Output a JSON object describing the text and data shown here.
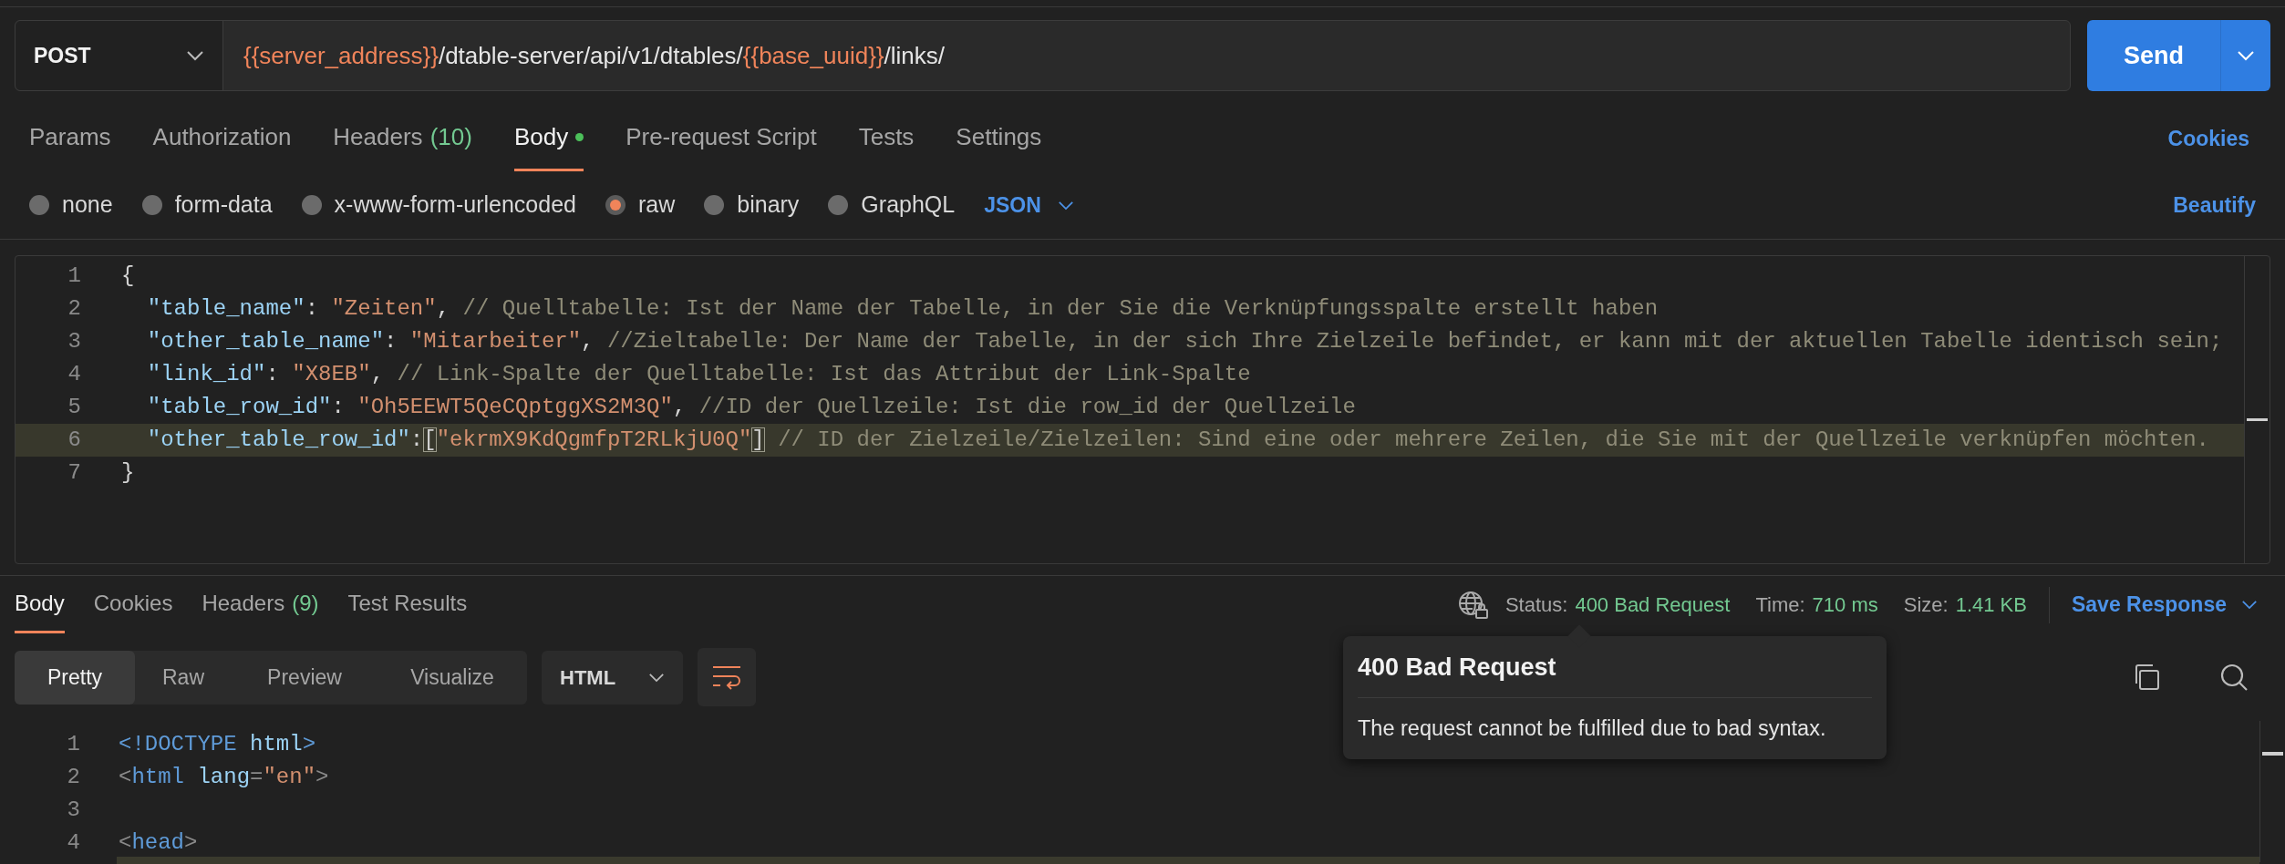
{
  "request": {
    "method": "POST",
    "url_parts": [
      {
        "kind": "variable",
        "text": "{{server_address}}"
      },
      {
        "kind": "path",
        "text": "/dtable-server/api/v1/dtables/"
      },
      {
        "kind": "variable",
        "text": "{{base_uuid}}"
      },
      {
        "kind": "path",
        "text": "/links/"
      }
    ],
    "send_label": "Send"
  },
  "request_tabs": [
    {
      "label": "Params",
      "selected": false
    },
    {
      "label": "Authorization",
      "selected": false
    },
    {
      "label": "Headers",
      "count": "(10)",
      "selected": false
    },
    {
      "label": "Body",
      "selected": true,
      "has_content": true
    },
    {
      "label": "Pre-request Script",
      "selected": false
    },
    {
      "label": "Tests",
      "selected": false
    },
    {
      "label": "Settings",
      "selected": false
    }
  ],
  "cookies_link": "Cookies",
  "body_types": [
    {
      "label": "none",
      "selected": false
    },
    {
      "label": "form-data",
      "selected": false
    },
    {
      "label": "x-www-form-urlencoded",
      "selected": false
    },
    {
      "label": "raw",
      "selected": true
    },
    {
      "label": "binary",
      "selected": false
    },
    {
      "label": "GraphQL",
      "selected": false
    }
  ],
  "body_format": "JSON",
  "beautify_link": "Beautify",
  "request_body": [
    {
      "number": "1",
      "highlighted": false,
      "tokens": [
        {
          "kind": "punct",
          "text": "{"
        }
      ]
    },
    {
      "number": "2",
      "highlighted": false,
      "tokens": [
        {
          "kind": "key",
          "text": "  \"table_name\""
        },
        {
          "kind": "punct",
          "text": ": "
        },
        {
          "kind": "string",
          "text": "\"Zeiten\""
        },
        {
          "kind": "punct",
          "text": ", "
        },
        {
          "kind": "comment",
          "text": "// Quelltabelle: Ist der Name der Tabelle, in der Sie die Verknüpfungsspalte erstellt haben"
        }
      ]
    },
    {
      "number": "3",
      "highlighted": false,
      "tokens": [
        {
          "kind": "key",
          "text": "  \"other_table_name\""
        },
        {
          "kind": "punct",
          "text": ": "
        },
        {
          "kind": "string",
          "text": "\"Mitarbeiter\""
        },
        {
          "kind": "punct",
          "text": ", "
        },
        {
          "kind": "comment",
          "text": "//Zieltabelle: Der Name der Tabelle, in der sich Ihre Zielzeile befindet, er kann mit der aktuellen Tabelle identisch sein;"
        }
      ]
    },
    {
      "number": "4",
      "highlighted": false,
      "tokens": [
        {
          "kind": "key",
          "text": "  \"link_id\""
        },
        {
          "kind": "punct",
          "text": ": "
        },
        {
          "kind": "string",
          "text": "\"X8EB\""
        },
        {
          "kind": "punct",
          "text": ", "
        },
        {
          "kind": "comment",
          "text": "// Link-Spalte der Quelltabelle: Ist das Attribut der Link-Spalte"
        }
      ]
    },
    {
      "number": "5",
      "highlighted": false,
      "tokens": [
        {
          "kind": "key",
          "text": "  \"table_row_id\""
        },
        {
          "kind": "punct",
          "text": ": "
        },
        {
          "kind": "string",
          "text": "\"Oh5EEWT5QeCQptggXS2M3Q\""
        },
        {
          "kind": "punct",
          "text": ", "
        },
        {
          "kind": "comment",
          "text": "//ID der Quellzeile: Ist die row_id der Quellzeile"
        }
      ]
    },
    {
      "number": "6",
      "highlighted": true,
      "tokens": [
        {
          "kind": "key",
          "text": "  \"other_table_row_id\""
        },
        {
          "kind": "punct",
          "text": ":"
        },
        {
          "kind": "bracket",
          "text": "["
        },
        {
          "kind": "string",
          "text": "\"ekrmX9KdQgmfpT2RLkjU0Q\""
        },
        {
          "kind": "bracket",
          "text": "]"
        },
        {
          "kind": "comment",
          "text": " // ID der Zielzeile/Zielzeilen: Sind eine oder mehrere Zeilen, die Sie mit der Quellzeile verknüpfen möchten."
        }
      ]
    },
    {
      "number": "7",
      "highlighted": false,
      "tokens": [
        {
          "kind": "punct",
          "text": "}"
        }
      ]
    }
  ],
  "response": {
    "tabs": [
      {
        "label": "Body",
        "selected": true
      },
      {
        "label": "Cookies",
        "selected": false
      },
      {
        "label": "Headers",
        "count": "(9)",
        "selected": false
      },
      {
        "label": "Test Results",
        "selected": false
      }
    ],
    "status_label": "Status:",
    "status": "400 Bad Request",
    "time_label": "Time:",
    "time": "710 ms",
    "size_label": "Size:",
    "size": "1.41 KB",
    "save_label": "Save Response",
    "views": [
      {
        "label": "Pretty",
        "selected": true
      },
      {
        "label": "Raw",
        "selected": false
      },
      {
        "label": "Preview",
        "selected": false
      },
      {
        "label": "Visualize",
        "selected": false
      }
    ],
    "format": "HTML",
    "lines": [
      {
        "number": "1",
        "tokens": [
          {
            "kind": "tag",
            "text": "<!DOCTYPE"
          },
          {
            "kind": "attr",
            "text": " html"
          },
          {
            "kind": "tag",
            "text": ">"
          }
        ]
      },
      {
        "number": "2",
        "tokens": [
          {
            "kind": "bracket",
            "text": "<"
          },
          {
            "kind": "tag",
            "text": "html"
          },
          {
            "kind": "attr",
            "text": " lang"
          },
          {
            "kind": "bracket",
            "text": "="
          },
          {
            "kind": "string",
            "text": "\"en\""
          },
          {
            "kind": "bracket",
            "text": ">"
          }
        ]
      },
      {
        "number": "3"
      },
      {
        "number": "4",
        "tokens": [
          {
            "kind": "bracket",
            "text": "<"
          },
          {
            "kind": "tag",
            "text": "head"
          },
          {
            "kind": "bracket",
            "text": ">"
          }
        ]
      }
    ]
  },
  "tooltip": {
    "title": "400 Bad Request",
    "text": "The request cannot be fulfilled due to bad syntax."
  }
}
